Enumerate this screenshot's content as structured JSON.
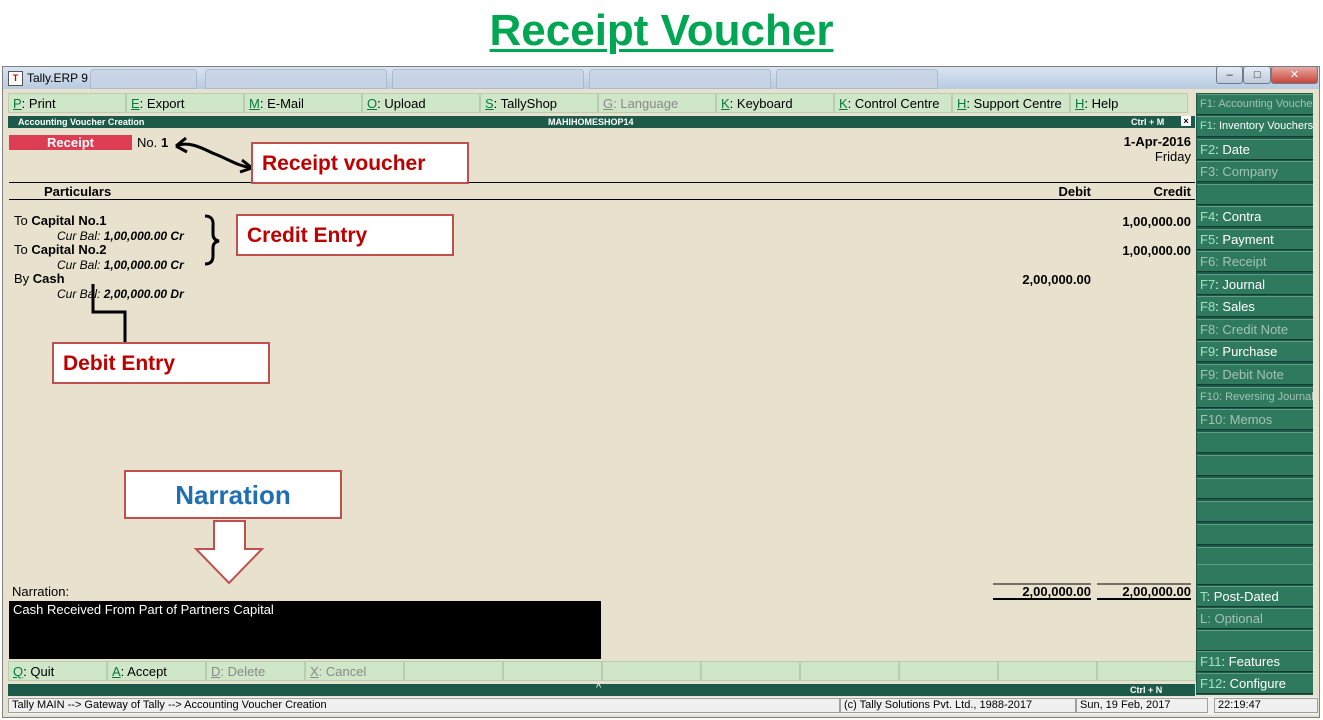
{
  "heading": "Receipt Voucher",
  "window": {
    "title": "Tally.ERP 9",
    "icon_text": "T"
  },
  "menu": [
    {
      "key": "P",
      "label": ": Print",
      "enabled": true
    },
    {
      "key": "E",
      "label": ": Export",
      "enabled": true
    },
    {
      "key": "M",
      "label": ": E-Mail",
      "enabled": true
    },
    {
      "key": "O",
      "label": ": Upload",
      "enabled": true
    },
    {
      "key": "S",
      "label": ": TallyShop",
      "enabled": true
    },
    {
      "key": "G",
      "label": ": Language",
      "enabled": false
    },
    {
      "key": "K",
      "label": ": Keyboard",
      "enabled": true
    },
    {
      "key": "K",
      "label": ": Control Centre",
      "enabled": true
    },
    {
      "key": "H",
      "label": ": Support Centre",
      "enabled": true
    },
    {
      "key": "H",
      "label": ": Help",
      "enabled": true
    }
  ],
  "form": {
    "title": "Accounting Voucher Creation",
    "company": "MAHIHOMESHOP14",
    "shortcut": "Ctrl + M",
    "close": "×"
  },
  "voucher": {
    "type": "Receipt",
    "no_label": "No.",
    "no": "1",
    "date": "1-Apr-2016",
    "day": "Friday"
  },
  "columns": {
    "particulars": "Particulars",
    "debit": "Debit",
    "credit": "Credit"
  },
  "entries": [
    {
      "prefix": "To",
      "ledger": "Capital No.1",
      "bal_label": "Cur Bal:",
      "bal": "1,00,000.00 Cr",
      "debit": "",
      "credit": "1,00,000.00"
    },
    {
      "prefix": "To",
      "ledger": "Capital No.2",
      "bal_label": "Cur Bal:",
      "bal": "1,00,000.00 Cr",
      "debit": "",
      "credit": "1,00,000.00"
    },
    {
      "prefix": "By",
      "ledger": "Cash",
      "bal_label": "Cur Bal:",
      "bal": "2,00,000.00 Dr",
      "debit": "2,00,000.00",
      "credit": ""
    }
  ],
  "callouts": {
    "receipt": "Receipt voucher",
    "credit": "Credit Entry",
    "debit": "Debit Entry",
    "narration": "Narration"
  },
  "narration": {
    "label": "Narration:",
    "text": "Cash Received From Part of Partners Capital"
  },
  "totals": {
    "debit": "2,00,000.00",
    "credit": "2,00,000.00"
  },
  "bottom": [
    {
      "key": "Q",
      "label": ": Quit",
      "enabled": true
    },
    {
      "key": "A",
      "label": ": Accept",
      "enabled": true
    },
    {
      "key": "D",
      "label": ": Delete",
      "enabled": false
    },
    {
      "key": "X",
      "label": ": Cancel",
      "enabled": false
    }
  ],
  "bottom_shortcut": "Ctrl + N",
  "status": {
    "path": "Tally MAIN --> Gateway of Tally --> Accounting Voucher  Creation",
    "copyright": "(c) Tally Solutions Pvt. Ltd., 1988-2017",
    "date": "Sun, 19 Feb, 2017",
    "time": "22:19:47"
  },
  "sidebar": [
    {
      "key": "F1",
      "label": ": Accounting Vouchers",
      "enabled": false,
      "small": true
    },
    {
      "key": "F1",
      "label": ": Inventory Vouchers",
      "enabled": true,
      "small": true
    },
    {
      "key": "F2",
      "label": ": Date",
      "enabled": true
    },
    {
      "key": "F3",
      "label": ": Company",
      "enabled": false
    },
    {
      "key": "",
      "label": "",
      "enabled": false
    },
    {
      "key": "F4",
      "label": ": Contra",
      "enabled": true
    },
    {
      "key": "F5",
      "label": ": Payment",
      "enabled": true
    },
    {
      "key": "F6",
      "label": ": Receipt",
      "enabled": false
    },
    {
      "key": "F7",
      "label": ": Journal",
      "enabled": true
    },
    {
      "key": "F8",
      "label": ": Sales",
      "enabled": true
    },
    {
      "key": "F8",
      "label": ": Credit Note",
      "enabled": false
    },
    {
      "key": "F9",
      "label": ": Purchase",
      "enabled": true
    },
    {
      "key": "F9",
      "label": ": Debit Note",
      "enabled": false
    },
    {
      "key": "F10",
      "label": ": Reversing Journal",
      "enabled": false,
      "small": true
    },
    {
      "key": "F10",
      "label": ": Memos",
      "enabled": false
    }
  ],
  "sidebar_bottom": [
    {
      "key": "T",
      "label": ": Post-Dated",
      "enabled": true
    },
    {
      "key": "L",
      "label": ": Optional",
      "enabled": false
    },
    {
      "key": "",
      "label": "",
      "enabled": false
    },
    {
      "key": "F11",
      "label": ": Features",
      "enabled": true
    },
    {
      "key": "F12",
      "label": ": Configure",
      "enabled": true
    }
  ]
}
